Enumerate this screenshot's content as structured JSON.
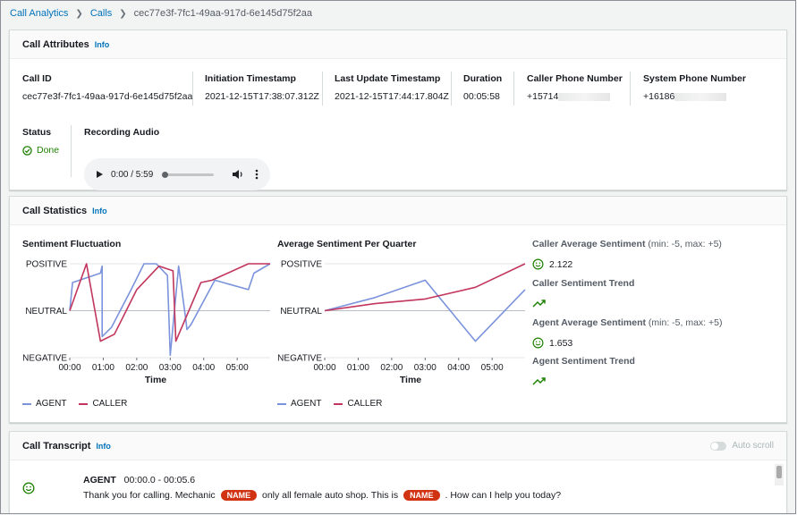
{
  "breadcrumb": {
    "root": "Call Analytics",
    "calls": "Calls",
    "current": "cec77e3f-7fc1-49aa-917d-6e145d75f2aa"
  },
  "attributes_panel": {
    "title": "Call Attributes",
    "info": "Info",
    "call_id_label": "Call ID",
    "call_id": "cec77e3f-7fc1-49aa-917d-6e145d75f2aa",
    "initiation_label": "Initiation Timestamp",
    "initiation": "2021-12-15T17:38:07.312Z",
    "update_label": "Last Update Timestamp",
    "update": "2021-12-15T17:44:17.804Z",
    "duration_label": "Duration",
    "duration": "00:05:58",
    "caller_phone_label": "Caller Phone Number",
    "caller_phone": "+15714",
    "system_phone_label": "System Phone Number",
    "system_phone": "+16186",
    "status_label": "Status",
    "status": "Done",
    "recording_label": "Recording Audio",
    "audio_time": "0:00 / 5:59"
  },
  "stats_panel": {
    "title": "Call Statistics",
    "info": "Info",
    "caller_avg_label": "Caller Average Sentiment",
    "range": "(min: -5, max: +5)",
    "caller_avg": "2.122",
    "caller_trend_label": "Caller Sentiment Trend",
    "agent_avg_label": "Agent Average Sentiment",
    "agent_avg": "1.653",
    "agent_trend_label": "Agent Sentiment Trend"
  },
  "colors": {
    "agent": "#7b93dc",
    "caller": "#c2355c",
    "ok": "#1d8102",
    "link": "#0073bb"
  },
  "chart_data": [
    {
      "type": "line",
      "title": "Sentiment Fluctuation",
      "xlabel": "Time",
      "ylabel": "",
      "x_ticks": [
        "00:00",
        "01:00",
        "02:00",
        "03:00",
        "04:00",
        "05:00"
      ],
      "y_ticks": [
        "NEGATIVE",
        "NEUTRAL",
        "POSITIVE"
      ],
      "xlim": [
        0,
        359
      ],
      "ylim": [
        -1,
        1
      ],
      "legend_position": "bottom-left",
      "series": [
        {
          "name": "AGENT",
          "x": [
            0,
            5,
            55,
            58,
            58,
            75,
            110,
            133,
            155,
            175,
            180,
            195,
            208,
            210,
            217,
            260,
            320,
            330,
            359
          ],
          "y": [
            0,
            0.6,
            0.8,
            0.95,
            -0.55,
            -0.35,
            0.45,
            1,
            1,
            0.75,
            -0.95,
            0.95,
            -0.2,
            -0.4,
            -0.3,
            0.65,
            0.45,
            0.8,
            1
          ]
        },
        {
          "name": "CALLER",
          "x": [
            0,
            30,
            55,
            80,
            120,
            160,
            185,
            190,
            235,
            255,
            320,
            359
          ],
          "y": [
            0,
            1,
            -0.65,
            -0.5,
            0.45,
            0.95,
            0.85,
            -0.65,
            0.6,
            0.65,
            1,
            1
          ]
        }
      ]
    },
    {
      "type": "line",
      "title": "Average Sentiment Per Quarter",
      "xlabel": "Time",
      "ylabel": "",
      "x_ticks": [
        "00:00",
        "01:00",
        "02:00",
        "03:00",
        "04:00",
        "05:00"
      ],
      "y_ticks": [
        "NEGATIVE",
        "NEUTRAL",
        "POSITIVE"
      ],
      "xlim": [
        0,
        359
      ],
      "ylim": [
        -1,
        1
      ],
      "legend_position": "bottom-left",
      "series": [
        {
          "name": "AGENT",
          "x": [
            0,
            90,
            180,
            270,
            359
          ],
          "y": [
            0,
            0.28,
            0.65,
            -0.65,
            0.45
          ]
        },
        {
          "name": "CALLER",
          "x": [
            0,
            90,
            180,
            270,
            359
          ],
          "y": [
            0,
            0.15,
            0.25,
            0.5,
            1
          ]
        }
      ]
    }
  ],
  "transcript_panel": {
    "title": "Call Transcript",
    "info": "Info",
    "auto_scroll": "Auto scroll",
    "speaker": "AGENT",
    "time_range": "00:00.0 - 00:05.6",
    "text_1": "Thank you for calling. Mechanic",
    "pii_1": "NAME",
    "text_2": "only all female auto shop. This is",
    "pii_2": "NAME",
    "text_3": ". How can I help you today?"
  }
}
